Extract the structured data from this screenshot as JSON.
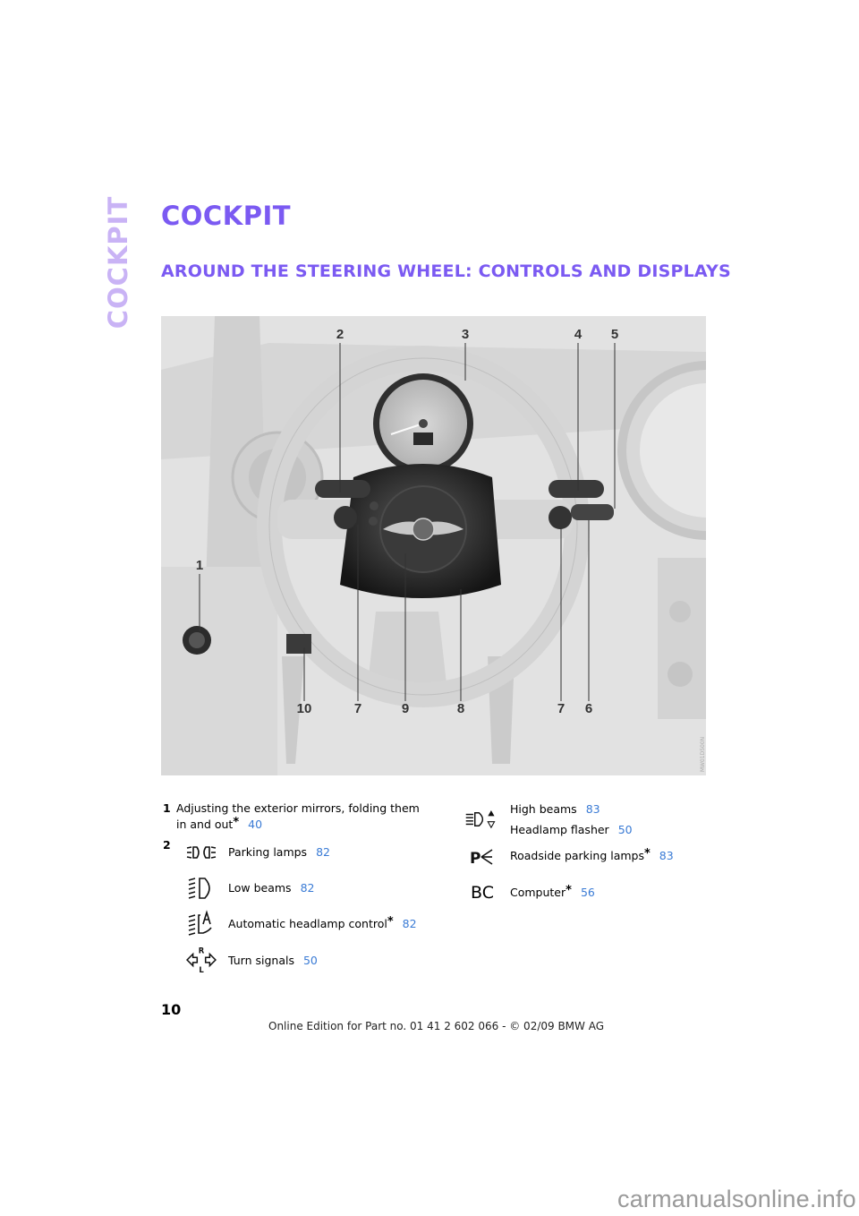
{
  "side_tab": {
    "label": "Cockpit"
  },
  "page": {
    "title": "Cockpit",
    "section_title": "Around the steering wheel: controls and displays"
  },
  "figure": {
    "description": "Steering wheel and dashboard illustration with numbered callouts",
    "callouts": [
      "2",
      "3",
      "4",
      "5",
      "1",
      "10",
      "7",
      "9",
      "8",
      "7",
      "6"
    ],
    "code": "MW01D500N"
  },
  "legend": {
    "items": [
      {
        "number": "1",
        "text": "Adjusting the exterior mirrors, folding them in and out",
        "line1": "Adjusting the exterior mirrors, folding them",
        "line2": "in and out",
        "optional": true,
        "page": "40"
      },
      {
        "number": "2",
        "subitems": [
          {
            "icon": "parking-lamps-icon",
            "text": "Parking lamps",
            "optional": false,
            "page": "82"
          },
          {
            "icon": "low-beams-icon",
            "text": "Low beams",
            "optional": false,
            "page": "82"
          },
          {
            "icon": "automatic-headlamp-icon",
            "text": "Automatic headlamp control",
            "optional": true,
            "page": "82"
          },
          {
            "icon": "turn-signals-icon",
            "text": "Turn signals",
            "optional": false,
            "page": "50"
          },
          {
            "icon": "high-beams-icon",
            "text": "High beams",
            "optional": false,
            "page": "83",
            "text2": "Headlamp flasher",
            "page2": "50"
          },
          {
            "icon": "roadside-parking-lamps-icon",
            "text": "Roadside parking lamps",
            "optional": true,
            "page": "83"
          },
          {
            "icon": "computer-icon",
            "icon_text": "BC",
            "text": "Computer",
            "optional": true,
            "page": "56"
          }
        ]
      }
    ],
    "star": "*",
    "turn_signal_letters": {
      "right": "R",
      "left": "L"
    }
  },
  "footer": {
    "page_number": "10",
    "edition": "Online Edition for Part no. 01 41 2 602 066 - © 02/09 BMW AG"
  },
  "watermark": "carmanualsonline.info",
  "colors": {
    "heading": "#7b5af2",
    "side_tab": "#c9b3f5",
    "page_ref": "#3a7bd5"
  }
}
